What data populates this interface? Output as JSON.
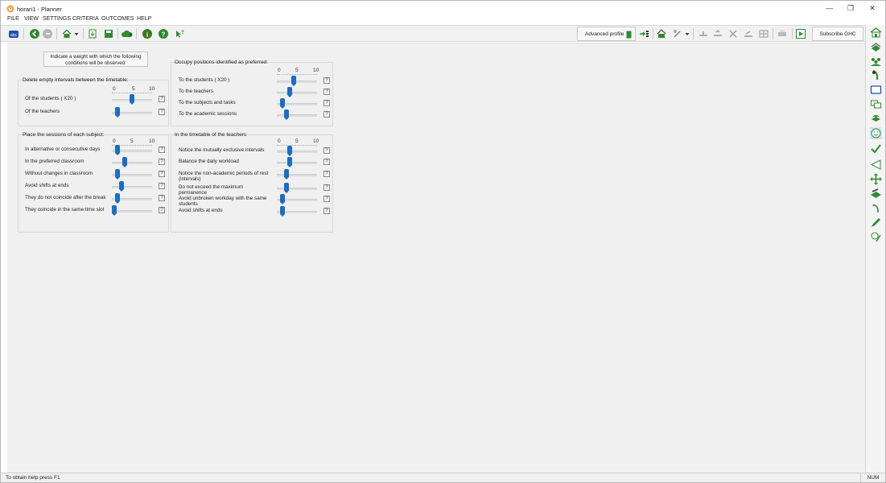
{
  "window": {
    "title": "horari1 - Planner",
    "minimize": "—",
    "restore": "❐",
    "close": "✕"
  },
  "menu": [
    "FILE",
    "VIEW",
    "SETTINGS",
    "CRITERIA",
    "OUTCOMES",
    "HELP"
  ],
  "toolbar": {
    "advanced_profile_label": "Advanced profile",
    "subscribe_label": "Subscribe GHC"
  },
  "hint": "Indicate a weight with which the following conditions will be observed:",
  "scale": {
    "min": "0",
    "mid": "5",
    "max": "10"
  },
  "help_label": "?",
  "panels": {
    "empty_intervals": {
      "title": "Delete empty intervals between the timetable:",
      "rows": [
        {
          "label": "Of the students  ( X20 )",
          "value": 5
        },
        {
          "label": "Of the teachers",
          "value": 1
        }
      ]
    },
    "sessions": {
      "title": "Place the sessions of each subject:",
      "rows": [
        {
          "label": "In alternative or consecutive days",
          "value": 1
        },
        {
          "label": "In the preferred classroom",
          "value": 3
        },
        {
          "label": "Without changes in classroom",
          "value": 1
        },
        {
          "label": "Avoid shifts at ends",
          "value": 2
        },
        {
          "label": "They do not coincide after the break",
          "value": 1
        },
        {
          "label": "They coincide in the same time slot",
          "value": 0
        }
      ]
    },
    "positions": {
      "title": "Occupy positions identified as preferred:",
      "rows": [
        {
          "label": "To the students  ( X20 )",
          "value": 4
        },
        {
          "label": "To the teachers",
          "value": 3
        },
        {
          "label": "To the subjects and tasks",
          "value": 1
        },
        {
          "label": "To the academic sessions",
          "value": 2
        }
      ]
    },
    "teachers": {
      "title": "In the timetable of the teachers",
      "rows": [
        {
          "label": "Notice the mutually exclusive intervals",
          "value": 3
        },
        {
          "label": "Balance the daily workload",
          "value": 3
        },
        {
          "label": "Notice the non-academic periods of rest (intervals)",
          "value": 2
        },
        {
          "label": "Do not exceed the maximum permanence",
          "value": 2
        },
        {
          "label": "Avoid unbroken workday with the same students",
          "value": 1
        },
        {
          "label": "Avoid shifts at ends",
          "value": 1
        }
      ]
    }
  },
  "status": {
    "left": "To obtain help press F1",
    "right": "NUM"
  },
  "colors": {
    "accent": "#1b6ec2",
    "green": "#2e8b2e",
    "panel_bg": "#f0f0f0"
  }
}
